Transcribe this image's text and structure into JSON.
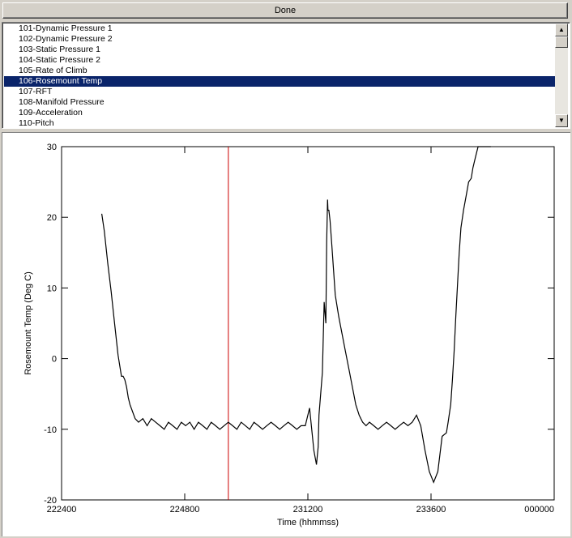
{
  "done_button": {
    "label": "Done"
  },
  "parameter_list": {
    "items": [
      "101-Dynamic Pressure 1",
      "102-Dynamic Pressure 2",
      "103-Static Pressure 1",
      "104-Static Pressure 2",
      "105-Rate of Climb",
      "106-Rosemount Temp",
      "107-RFT",
      "108-Manifold Pressure",
      "109-Acceleration",
      "110-Pitch"
    ],
    "selected": "106-Rosemount Temp",
    "scroll_up_icon": "up-arrow-icon",
    "scroll_down_icon": "down-arrow-icon"
  },
  "chart_data": {
    "type": "line",
    "xlabel": "Time (hhmmss)",
    "ylabel": "Rosemount Temp (Deg C)",
    "x_tick_labels": [
      "222400",
      "224800",
      "231200",
      "233600",
      "000000"
    ],
    "x_tick_seconds": [
      0,
      1440,
      2880,
      4320,
      5760
    ],
    "ylim": [
      -20,
      30
    ],
    "y_ticks": [
      -20,
      -10,
      0,
      10,
      20,
      30
    ],
    "y_tick_labels": [
      "-20",
      "-10",
      "0",
      "10",
      "20",
      "30"
    ],
    "grid": false,
    "marker_line": {
      "x_seconds": 1950,
      "color": "#cc0000"
    },
    "series": [
      {
        "color": "#000000",
        "x_seconds": [
          470,
          500,
          540,
          580,
          620,
          660,
          700,
          720,
          740,
          760,
          780,
          800,
          830,
          860,
          900,
          950,
          1000,
          1050,
          1100,
          1150,
          1200,
          1250,
          1300,
          1350,
          1400,
          1450,
          1500,
          1550,
          1600,
          1650,
          1700,
          1750,
          1800,
          1850,
          1900,
          1950,
          2000,
          2050,
          2100,
          2150,
          2200,
          2250,
          2300,
          2350,
          2400,
          2450,
          2500,
          2550,
          2600,
          2650,
          2700,
          2750,
          2800,
          2850,
          2900,
          2950,
          2980,
          3000,
          3010,
          3030,
          3050,
          3070,
          3090,
          3100,
          3110,
          3115,
          3125,
          3140,
          3160,
          3180,
          3200,
          3240,
          3280,
          3320,
          3360,
          3400,
          3440,
          3480,
          3520,
          3560,
          3600,
          3650,
          3700,
          3750,
          3800,
          3850,
          3900,
          3950,
          4000,
          4050,
          4100,
          4150,
          4200,
          4250,
          4300,
          4350,
          4400,
          4450,
          4500,
          4520,
          4550,
          4570,
          4590,
          4610,
          4630,
          4650,
          4670,
          4700,
          4730,
          4760,
          4790,
          4810,
          4830,
          4850,
          4870,
          4880,
          4900,
          4920,
          4940,
          4960,
          4980,
          5000,
          5020
        ],
        "y": [
          20.5,
          18.0,
          13.5,
          9.5,
          5.0,
          0.5,
          -2.5,
          -2.5,
          -3.0,
          -4.0,
          -5.5,
          -6.5,
          -7.5,
          -8.5,
          -9.0,
          -8.5,
          -9.5,
          -8.5,
          -9.0,
          -9.5,
          -10.0,
          -9.0,
          -9.5,
          -10.0,
          -9.0,
          -9.5,
          -9.0,
          -10.0,
          -9.0,
          -9.5,
          -10.0,
          -9.0,
          -9.5,
          -10.0,
          -9.5,
          -9.0,
          -9.5,
          -10.0,
          -9.0,
          -9.5,
          -10.0,
          -9.0,
          -9.5,
          -10.0,
          -9.5,
          -9.0,
          -9.5,
          -10.0,
          -9.5,
          -9.0,
          -9.5,
          -10.0,
          -9.5,
          -9.5,
          -7.0,
          -13.0,
          -15.0,
          -12.5,
          -8.0,
          -5.0,
          -2.0,
          8.0,
          5.0,
          16.5,
          22.5,
          21.0,
          21.0,
          19.5,
          16.0,
          12.5,
          9.0,
          6.0,
          3.5,
          1.0,
          -1.5,
          -4.0,
          -6.5,
          -8.0,
          -9.0,
          -9.5,
          -9.0,
          -9.5,
          -10.0,
          -9.5,
          -9.0,
          -9.5,
          -10.0,
          -9.5,
          -9.0,
          -9.5,
          -9.0,
          -8.0,
          -9.5,
          -13.0,
          -16.0,
          -17.5,
          -16.0,
          -11.0,
          -10.5,
          -9.0,
          -6.5,
          -3.0,
          1.0,
          6.0,
          10.5,
          15.0,
          18.5,
          21.0,
          23.0,
          25.0,
          25.5,
          27.0,
          28.0,
          29.0,
          30.0,
          30.0,
          30.0,
          30.0,
          30.0,
          30.0,
          30.0,
          30.0,
          30.0,
          30.0
        ]
      }
    ]
  }
}
